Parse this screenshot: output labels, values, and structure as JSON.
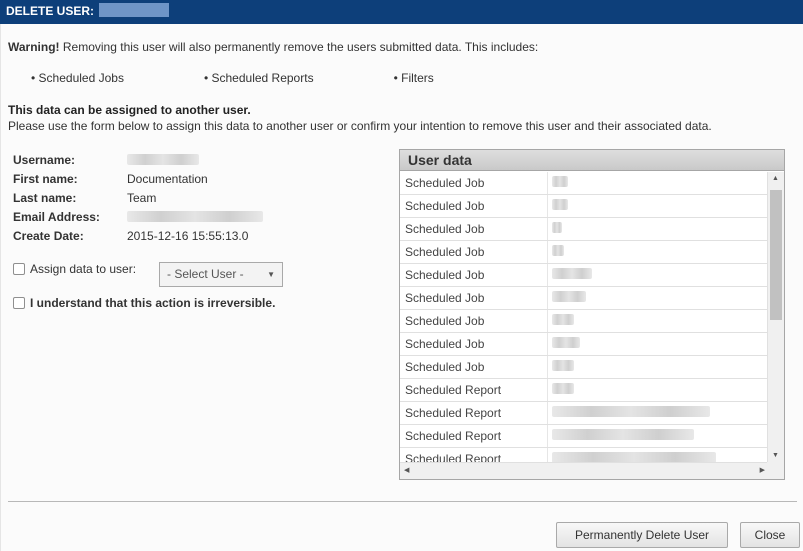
{
  "title": "DELETE USER:",
  "warning": {
    "bold": "Warning!",
    "text": " Removing this user will also permanently remove the users submitted data. This includes:"
  },
  "includes": [
    "Scheduled Jobs",
    "Scheduled Reports",
    "Filters"
  ],
  "assign_heading": "This data can be assigned to another user.",
  "assign_text": "Please use the form below to assign this data to another user or confirm your intention to remove this user and their associated data.",
  "user_info": [
    {
      "label": "Username:",
      "value": ""
    },
    {
      "label": "First name:",
      "value": "Documentation"
    },
    {
      "label": "Last name:",
      "value": "Team"
    },
    {
      "label": "Email Address:",
      "value": ""
    },
    {
      "label": "Create Date:",
      "value": "2015-12-16 15:55:13.0"
    }
  ],
  "assign_label": "Assign data to user:",
  "select_placeholder": "- Select User -",
  "understand_label": "I understand that this action is irreversible.",
  "user_data": {
    "title": "User data",
    "rows": [
      "Scheduled Job",
      "Scheduled Job",
      "Scheduled Job",
      "Scheduled Job",
      "Scheduled Job",
      "Scheduled Job",
      "Scheduled Job",
      "Scheduled Job",
      "Scheduled Job",
      "Scheduled Report",
      "Scheduled Report",
      "Scheduled Report",
      "Scheduled Report"
    ]
  },
  "buttons": {
    "delete": "Permanently Delete User",
    "close": "Close"
  },
  "colors": {
    "titlebar": "#0d3f7a",
    "panel_header": "#d4d4d4"
  }
}
